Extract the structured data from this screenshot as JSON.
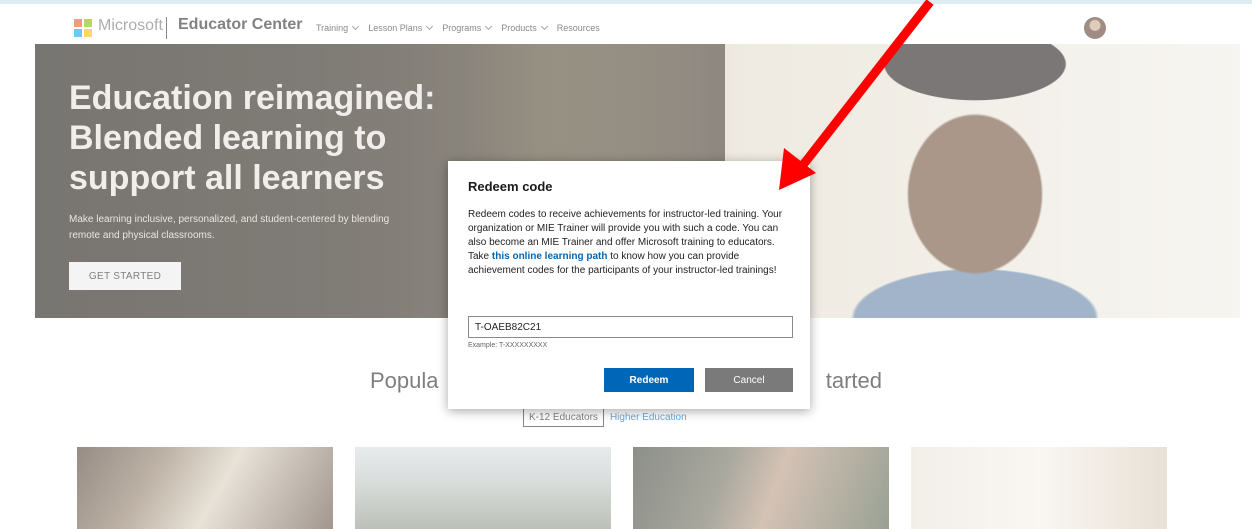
{
  "header": {
    "brand": "Microsoft",
    "site_name": "Educator Center",
    "nav": [
      {
        "label": "Training",
        "dropdown": true
      },
      {
        "label": "Lesson Plans",
        "dropdown": true
      },
      {
        "label": "Programs",
        "dropdown": true
      },
      {
        "label": "Products",
        "dropdown": true
      },
      {
        "label": "Resources",
        "dropdown": false
      }
    ]
  },
  "hero": {
    "title": "Education reimagined: Blended learning to support all learners",
    "subtitle": "Make learning inclusive, personalized, and student-centered by blending remote and physical classrooms.",
    "cta": "GET STARTED"
  },
  "section": {
    "title_left": "Popula",
    "title_right": "tarted",
    "audience_selected": "K-12 Educators",
    "audience_other": "Higher Education"
  },
  "dialog": {
    "title": "Redeem code",
    "body_before": "Redeem codes to receive achievements for instructor-led training. Your organization or MIE Trainer will provide you with such a code. You can also become an MIE Trainer and offer Microsoft training to educators. Take ",
    "link": "this online learning path",
    "body_after": " to know how you can provide achievement codes for the participants of your instructor-led trainings!",
    "input_value": "T-OAEB82C21",
    "example": "Example: T-XXXXXXXXX",
    "redeem_label": "Redeem",
    "cancel_label": "Cancel"
  },
  "colors": {
    "accent": "#0067b8",
    "cancel": "#7a7a7a",
    "annotation": "#ff0000"
  }
}
